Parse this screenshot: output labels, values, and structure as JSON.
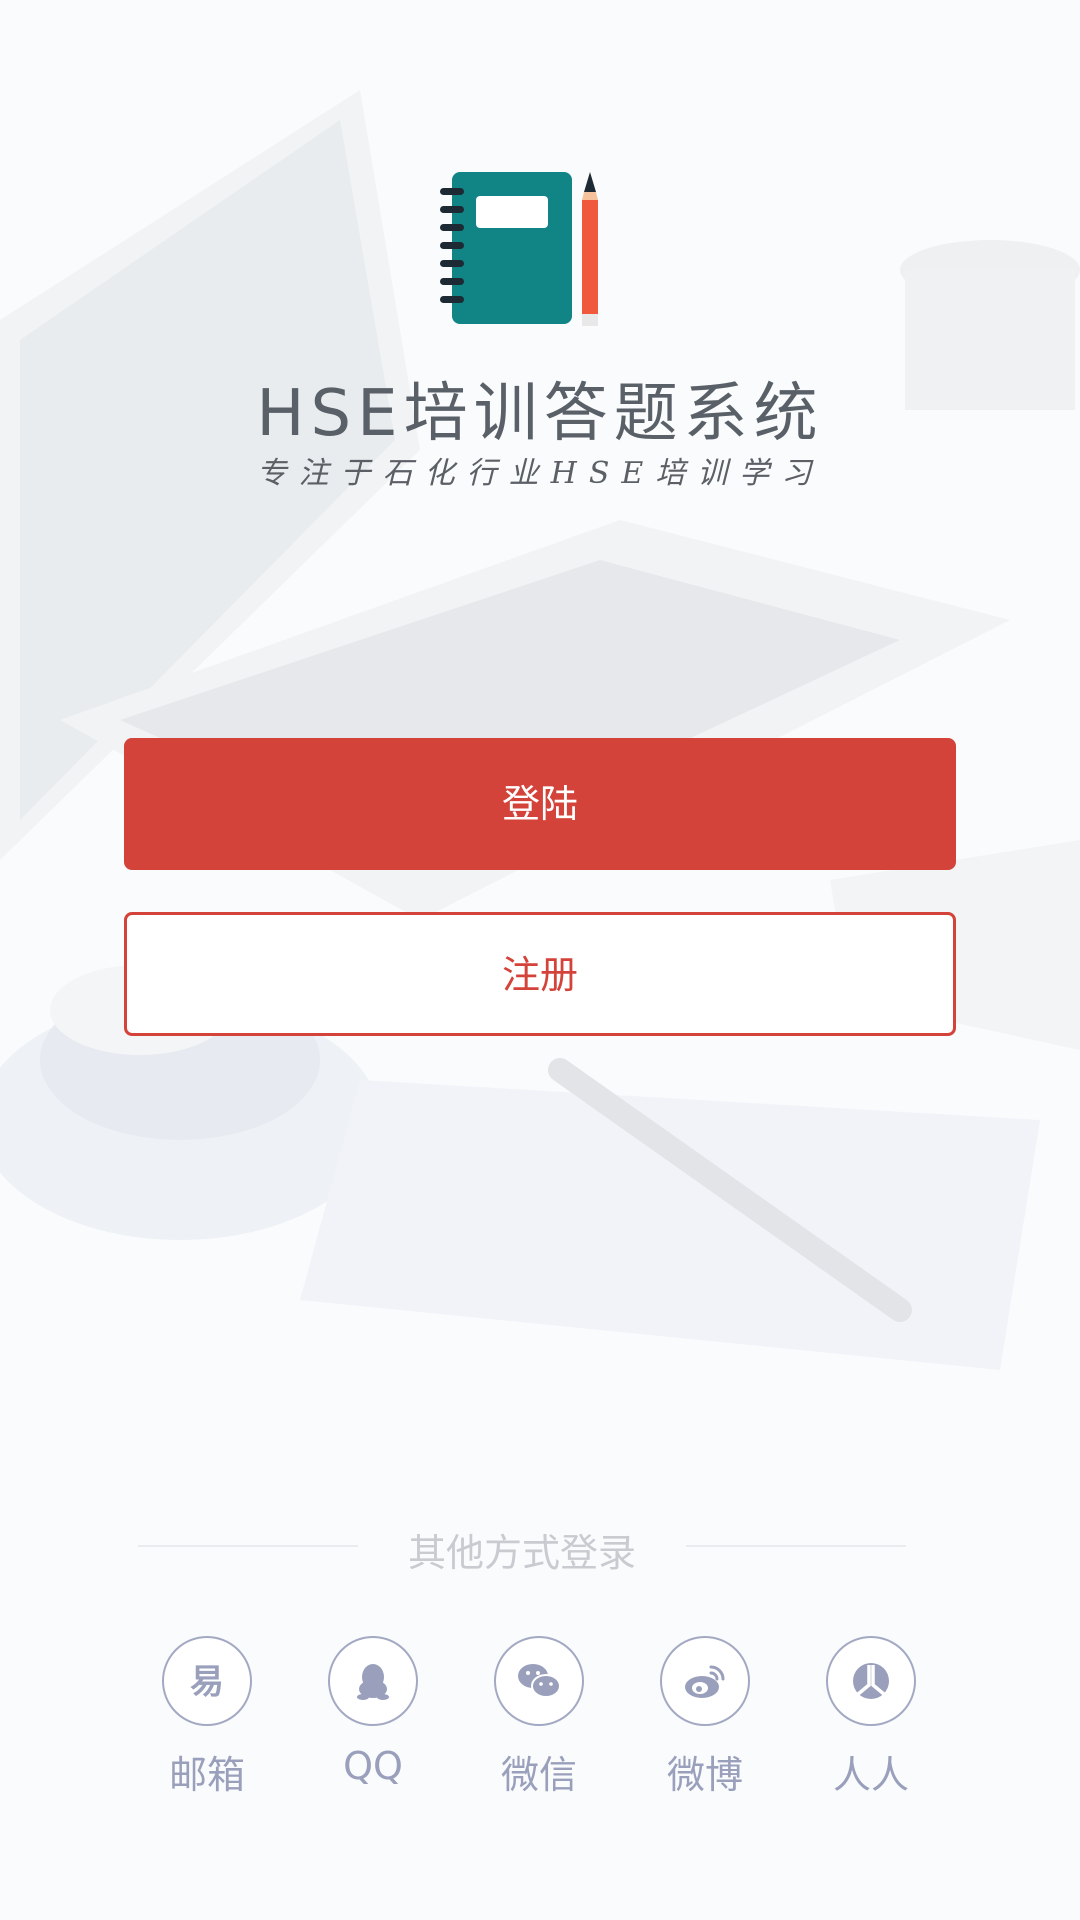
{
  "app": {
    "title": "HSE培训答题系统",
    "subtitle": "专注于石化行业HSE培训学习"
  },
  "actions": {
    "login_label": "登陆",
    "register_label": "注册"
  },
  "other_login": {
    "label": "其他方式登录",
    "items": [
      {
        "label": "邮箱",
        "icon": "email-icon"
      },
      {
        "label": "QQ",
        "icon": "qq-icon"
      },
      {
        "label": "微信",
        "icon": "wechat-icon"
      },
      {
        "label": "微博",
        "icon": "weibo-icon"
      },
      {
        "label": "人人",
        "icon": "renren-icon"
      }
    ]
  },
  "colors": {
    "accent": "#d3433a",
    "icon_gray": "#9aa0bc",
    "title_gray": "#5a6068",
    "notebook_teal": "#118585",
    "pencil_orange": "#f05a3c"
  }
}
